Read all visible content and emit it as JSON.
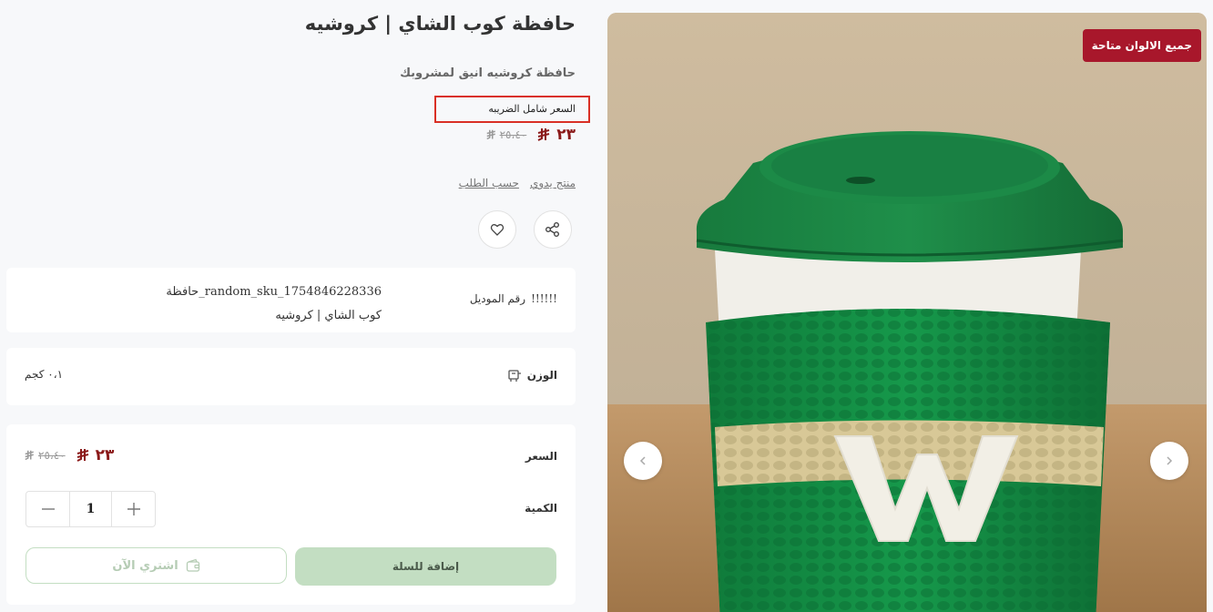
{
  "product": {
    "title": "حافظة كوب الشاي | كروشيه",
    "subtitle": "حافظة كروشيه انيق لمشروبك",
    "tax_note": "السعر شامل الضريبه",
    "price_current": "٢٣",
    "price_old": "٢٥،٤٠",
    "tags": [
      "منتج يدوي",
      "حسب الطلب"
    ]
  },
  "gallery": {
    "badge": "جميع الالوان متاحة",
    "cup_letter": "W"
  },
  "model": {
    "label": "رقم الموديل",
    "prefix": "!!!!!!",
    "line1": "حافظة_random_sku_1754846228336",
    "line2": "كوب الشاي | كروشيه"
  },
  "weight": {
    "label": "الوزن",
    "value": "٠،١ كجم"
  },
  "purchase": {
    "price_label": "السعر",
    "price_current": "٢٣",
    "price_old": "٢٥،٤٠",
    "qty_label": "الكمية",
    "qty_value": "1",
    "add_to_cart": "إضافة للسلة",
    "buy_now": "اشتري الآن"
  },
  "icons": {
    "currency": "saudi-riyal-icon",
    "share": "share-icon",
    "favorite": "heart-icon",
    "weight": "scale-icon",
    "buy": "wallet-icon",
    "prev": "chevron-left-icon",
    "next": "chevron-right-icon"
  },
  "colors": {
    "accent_red": "#8b1a1a",
    "badge_red": "#a8172b",
    "cart_green": "#c3dec2"
  }
}
